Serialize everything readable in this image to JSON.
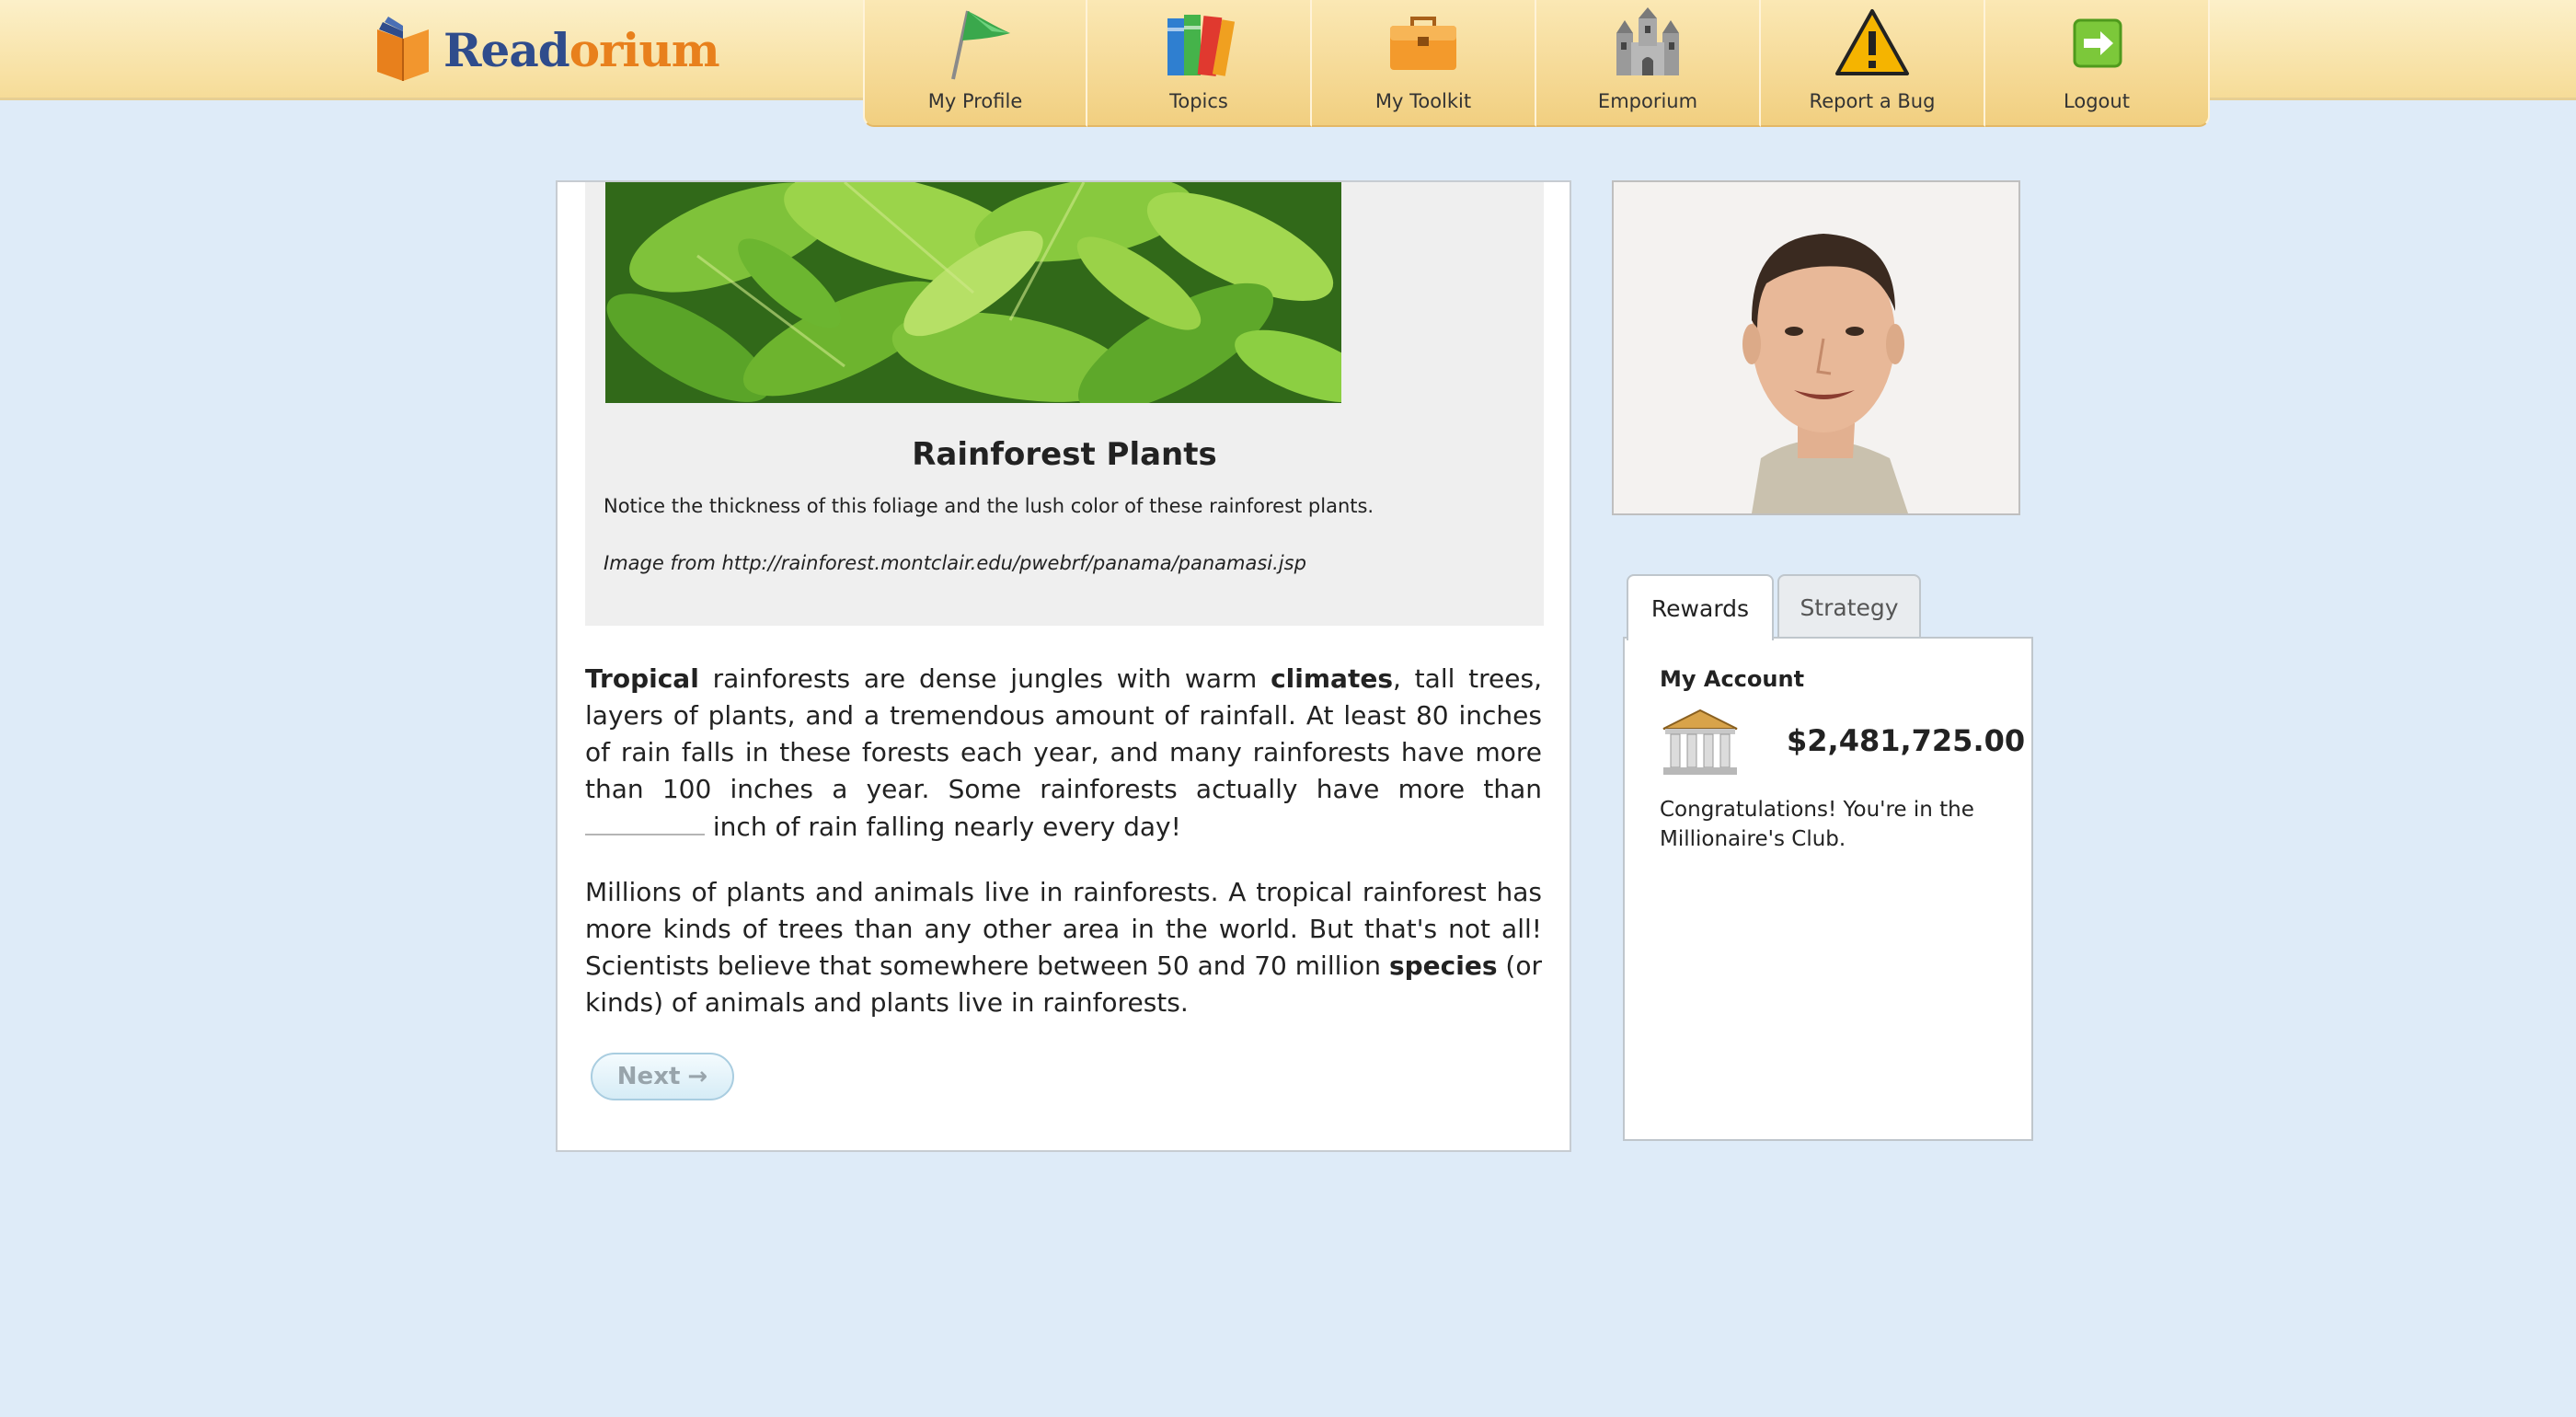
{
  "app": {
    "logo_read": "Read",
    "logo_orium": "orium",
    "brand_colors": {
      "read": "#2f4c8c",
      "orium": "#e8801c"
    }
  },
  "nav": {
    "items": [
      {
        "label": "My Profile",
        "icon": "flag-icon"
      },
      {
        "label": "Topics",
        "icon": "books-icon"
      },
      {
        "label": "My Toolkit",
        "icon": "toolbox-icon"
      },
      {
        "label": "Emporium",
        "icon": "castle-icon"
      },
      {
        "label": "Report a Bug",
        "icon": "warning-icon"
      },
      {
        "label": "Logout",
        "icon": "logout-arrow-icon"
      }
    ]
  },
  "figure": {
    "title": "Rainforest Plants",
    "caption": "Notice the thickness of this foliage and the lush color of these rainforest plants.",
    "credit": "Image from http://rainforest.montclair.edu/pwebrf/panama/panamasi.jsp"
  },
  "article": {
    "p1_bold1": "Tropical",
    "p1_text1": " rainforests are dense jungles with warm ",
    "p1_bold2": "climates",
    "p1_text2": ", tall trees, layers of plants, and a tremendous amount of rainfall. At least 80 inches of rain falls in these forests each year, and many rainforests have more than 100 inches a year. Some rainforests actually have more than ",
    "p1_text3": " inch of rain falling nearly every day!",
    "p2_text1": "Millions of plants and animals live in rainforests. A tropical rainforest has more kinds of trees than any other area in the world. But that's not all! Scientists believe that somewhere between 50 and 70 million ",
    "p2_bold": "species",
    "p2_text2": " (or kinds) of animals and plants live in rainforests."
  },
  "next_button": {
    "label": "Next",
    "arrow": "→"
  },
  "tabs": {
    "rewards": "Rewards",
    "strategy": "Strategy"
  },
  "account": {
    "title": "My Account",
    "balance": "$2,481,725.00",
    "message": "Congratulations! You're in the Millionaire's Club."
  }
}
